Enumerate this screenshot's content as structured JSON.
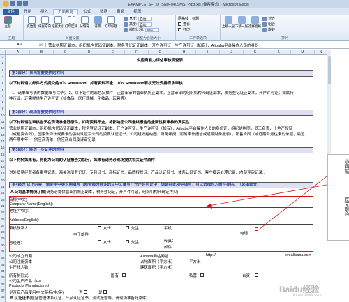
{
  "title_bar": {
    "title": "EXAMPLE_SFI_D_SN0+0409MS_Pgxt.xls  [兼容模式]  - Microsoft Excel"
  },
  "ribbon": {
    "tabs": [
      {
        "label": "文件"
      },
      {
        "label": "开始"
      },
      {
        "label": "插入"
      },
      {
        "label": "页面布局"
      },
      {
        "label": "公式"
      },
      {
        "label": "数据"
      },
      {
        "label": "审阅"
      },
      {
        "label": "视图"
      }
    ],
    "groups": {
      "theme": {
        "label": "主题",
        "buttons": [
          {
            "label": "主题"
          }
        ]
      },
      "page_setup": {
        "label": "页面设置",
        "buttons": [
          {
            "label": "页边距"
          },
          {
            "label": "纸张方向"
          },
          {
            "label": "纸张大小"
          },
          {
            "label": "打印区域"
          },
          {
            "label": "分隔符"
          },
          {
            "label": "背景"
          },
          {
            "label": "打印标题"
          }
        ]
      },
      "scale": {
        "label": "调整为合适大小",
        "width_label": "宽度:",
        "width_value": "自动",
        "height_label": "高度:",
        "height_value": "自动",
        "scale_label": "缩放比例:",
        "scale_value": "85%"
      },
      "sheet_options": {
        "label": "工作表选项",
        "gridlines": "网格线",
        "headings": "标题",
        "view": "查看",
        "print": "打印"
      },
      "arrange": {
        "label": "排列",
        "buttons": [
          {
            "label": "上移一层"
          },
          {
            "label": "下移一层"
          },
          {
            "label": "选择窗格"
          },
          {
            "label": "对齐"
          },
          {
            "label": "组合"
          },
          {
            "label": "旋转"
          }
        ]
      }
    }
  },
  "formula_bar": {
    "name_box": "A9",
    "fx": "fx",
    "content": "营业执照正副本，组织机构代码证副本，税务登记证正副本，开户许可证，生产许可证（如有），Alibaba平台操作人员的身份"
  },
  "columns": [
    "A",
    "B",
    "C",
    "D",
    "E",
    "F",
    "G",
    "H",
    "I",
    "J",
    "K",
    "L",
    "M",
    "N"
  ],
  "rows": [
    "1",
    "2",
    "3",
    "4",
    "5",
    "6",
    "7",
    "8",
    "9",
    "10",
    "11",
    "12",
    "13",
    "14",
    "15",
    "16",
    "17",
    "18",
    "19",
    "20",
    "21",
    "22",
    "23",
    "24",
    "25",
    "26",
    "27",
    "28",
    "29",
    "30",
    "31",
    "32",
    "33",
    "34",
    "35",
    "36",
    "37",
    "38"
  ],
  "sheet": {
    "doc_title": "供应商能力评估审核调查表",
    "sec1": "第1部分：事先需要提供的材料",
    "p1_title": "以下材料请以邮件方式提交给TÜV Rheinland：如有资料不全，TÜV Rheinland有权无法安排现场审核：",
    "p1_body": "1、请单填写表的数据填写完毕；    2、以下证件的彩色扫描件：正营审审的营业执照正副本，正营审审的组织机构代码证副本，税务登记证正副本，开户许可证；如属特",
    "p1_body2": "种行业，还需提供生产许可证（如食品、医疗器械、化妆品、玩具等）",
    "sec2": "第2部分：现场需要提供的材料",
    "p2_title": "以下材料请在审核当天在现场准备好原件，如有资料不全，将影响您公司最终报告的全面性和审核的真实性：",
    "p2_l1": "营业执照正副本，组织机构代码证正副本，税务登记证正副本，开户许可证，生产许可证（如有），Alibaba平台操作人员的身份证，组织结构图，员工名表，土地产权证",
    "p2_l2": "（或租赁合同），国家法律法规要求的强制认证及公司的资质认证证书，公司组织结构图，财务年报（可附审计报告或近期财务报表），销售合同（或近期业务往来的单据，最近",
    "p2_l3": "两年期中年），供应商清单，供应商合同及评审记录",
    "sec3": "第3部分：能进一步证明的材料",
    "p3_title": "以下材料如果有，将能为公司的认证报告力加分，如果有请务必现场提供相关证件原件：",
    "p3_body": "对外贸易经营者备案登记表、海关注册登记证、专利证书、商标证书、品牌授权证、产品认证证书、体系认证证书、客户投诉处理记录、内部评审记录...",
    "sec4": "第4部分 以下内容，请使用中英对照填写（附带部分标注的以中文填写）开户许可证中，请请在此项中填写，可以选择也为附件提供。（必填部分）",
    "a_title": "A.公司基本情况了解",
    "a_note": "(请务必提供营业执照正副本，税务登记证，开户许可证，组织机构代码证拷贝)",
    "f_name_cn": "名称(中文)",
    "f_name_en": "Company Name(English):",
    "f_addr_cn": "地址(中文)：",
    "f_addr_en": "Address(English):",
    "f_contact": "审核联系人：",
    "f_female": "女士",
    "f_male": "先生",
    "f_mobile": "手机：",
    "f_email": "电子邮件",
    "f_tel": "电话：",
    "f_manager": "总经理：",
    "f_ms": "女士",
    "f_mr": "先生",
    "f_fax": "传真：",
    "f_mail": "邮件：",
    "f_est": "公司成立日期",
    "f_alibaba": "Alibaba网站网址",
    "f_http": "http://",
    "f_url_suffix": "en.alibaba.com",
    "f_reg_cap": "公司注册资本",
    "f_area": "占地面积（平方米）",
    "f_sqm": "平方米",
    "f_building": "建筑面积（平方米）",
    "f_staff": "生产线人数",
    "f_ownership": "所有制形式",
    "f_state": "国有",
    "f_private": "私营",
    "f_foreign": "合资",
    "f_product": "公司生产产品（中）",
    "f_product_en": "Products Manufactured",
    "f_export": "是否有产品使用中 文英标(中/英)",
    "f_no": "否",
    "f_yes": "是",
    "b_title": "B.认证证书",
    "b_note": "(包括管理体系认证、产品认证证书、测试报告等，请现场准备好原件)"
  },
  "callout": {
    "text1": "小四框",
    "text2": "底文颜色"
  },
  "watermark": {
    "text": "Baidu经验",
    "sub": "jingyan.baidu.com"
  },
  "colors": {
    "ribbon_bg": "#dfe9f6",
    "section_bg": "#dce0f0",
    "section_text": "#1d3ca8",
    "highlight_red": "#d01818",
    "file_tab": "#2f5f9e"
  }
}
